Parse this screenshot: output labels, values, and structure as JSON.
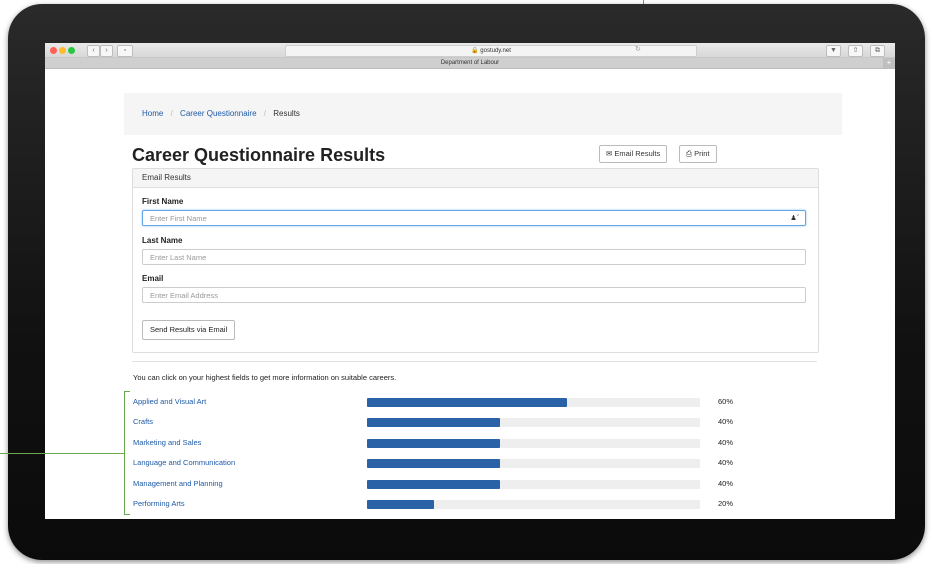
{
  "browser": {
    "url": "gostudy.net",
    "tab_title": "Department of Labour",
    "plus": "+"
  },
  "breadcrumb": {
    "home": "Home",
    "sep": "/",
    "questionnaire": "Career Questionnaire",
    "current": "Results"
  },
  "page": {
    "title": "Career Questionnaire Results",
    "email_results_button": "Email Results",
    "print_button": "Print"
  },
  "email_form": {
    "panel_title": "Email Results",
    "first_name_label": "First Name",
    "first_name_placeholder": "Enter First Name",
    "last_name_label": "Last Name",
    "last_name_placeholder": "Enter Last Name",
    "email_label": "Email",
    "email_placeholder": "Enter Email Address",
    "send_button": "Send Results via Email"
  },
  "results": {
    "intro": "You can click on your highest fields to get more information on suitable careers.",
    "items": [
      {
        "label": "Applied and Visual Art",
        "percent": 60,
        "percent_text": "60%"
      },
      {
        "label": "Crafts",
        "percent": 40,
        "percent_text": "40%"
      },
      {
        "label": "Marketing and Sales",
        "percent": 40,
        "percent_text": "40%"
      },
      {
        "label": "Language and Communication",
        "percent": 40,
        "percent_text": "40%"
      },
      {
        "label": "Management and Planning",
        "percent": 40,
        "percent_text": "40%"
      },
      {
        "label": "Performing Arts",
        "percent": 20,
        "percent_text": "20%"
      }
    ]
  },
  "colors": {
    "link": "#1e5aa8",
    "bar_fill": "#2a62a8",
    "bar_track": "#eeeeee",
    "callout": "#6aa84f"
  }
}
